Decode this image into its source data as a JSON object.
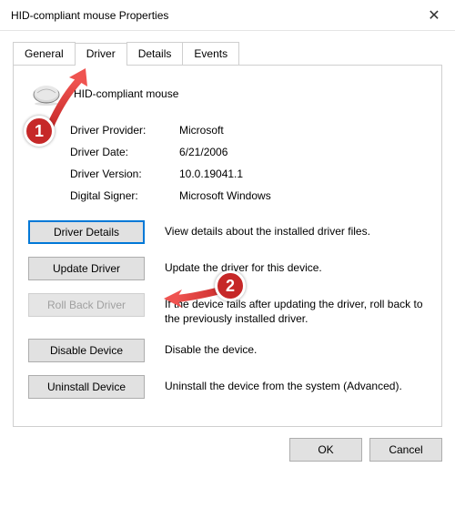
{
  "window": {
    "title": "HID-compliant mouse Properties"
  },
  "tabs": {
    "general": "General",
    "driver": "Driver",
    "details": "Details",
    "events": "Events"
  },
  "device": {
    "name": "HID-compliant mouse"
  },
  "props": {
    "provider_label": "Driver Provider:",
    "provider_value": "Microsoft",
    "date_label": "Driver Date:",
    "date_value": "6/21/2006",
    "version_label": "Driver Version:",
    "version_value": "10.0.19041.1",
    "signer_label": "Digital Signer:",
    "signer_value": "Microsoft Windows"
  },
  "buttons": {
    "details": "Driver Details",
    "details_desc": "View details about the installed driver files.",
    "update": "Update Driver",
    "update_desc": "Update the driver for this device.",
    "rollback": "Roll Back Driver",
    "rollback_desc": "If the device fails after updating the driver, roll back to the previously installed driver.",
    "disable": "Disable Device",
    "disable_desc": "Disable the device.",
    "uninstall": "Uninstall Device",
    "uninstall_desc": "Uninstall the device from the system (Advanced)."
  },
  "footer": {
    "ok": "OK",
    "cancel": "Cancel"
  },
  "annotations": {
    "badge1": "1",
    "badge2": "2"
  }
}
